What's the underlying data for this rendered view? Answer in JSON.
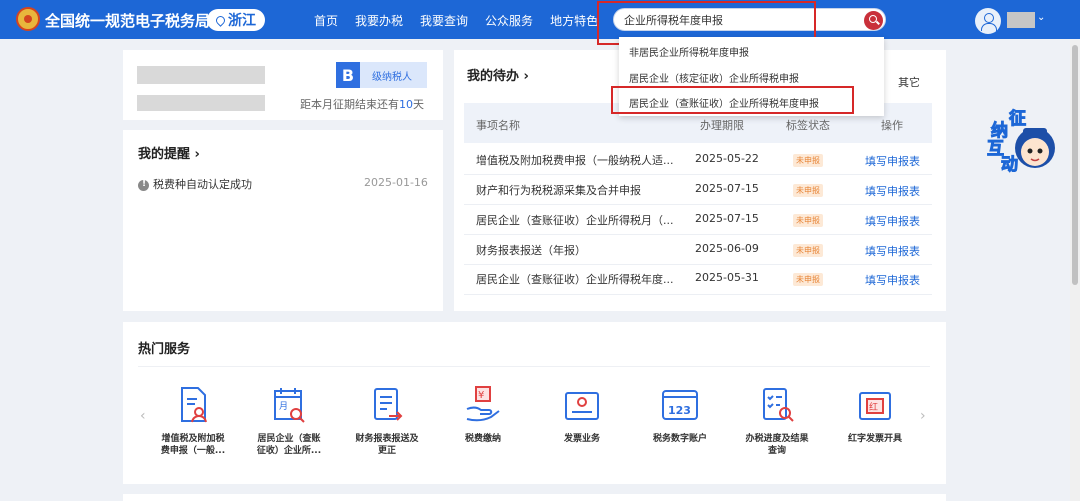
{
  "header": {
    "site_title": "全国统一规范电子税务局",
    "region": "浙江",
    "nav": [
      "首页",
      "我要办税",
      "我要查询",
      "公众服务",
      "地方特色"
    ],
    "search_value": "企业所得税年度申报"
  },
  "search_suggestions": [
    "非居民企业所得税年度申报",
    "居民企业（核定征收）企业所得税申报",
    "居民企业（查账征收）企业所得税年度申报"
  ],
  "profile": {
    "grade_letter": "B",
    "grade_text": "级纳税人",
    "deadline_prefix": "距本月征期结束还有",
    "deadline_days": "10",
    "deadline_suffix": "天"
  },
  "reminders": {
    "title": "我的提醒",
    "items": [
      {
        "text": "税费种自动认定成功",
        "date": "2025-01-16"
      }
    ]
  },
  "todo": {
    "title": "我的待办",
    "other_link": "其它",
    "columns": [
      "事项名称",
      "办理期限",
      "标签状态",
      "操作"
    ],
    "rows": [
      {
        "name": "增值税及附加税费申报（一般纳税人适...",
        "deadline": "2025-05-22",
        "status": "未申报",
        "action": "填写申报表"
      },
      {
        "name": "财产和行为税税源采集及合并申报",
        "deadline": "2025-07-15",
        "status": "未申报",
        "action": "填写申报表"
      },
      {
        "name": "居民企业（查账征收）企业所得税月（...",
        "deadline": "2025-07-15",
        "status": "未申报",
        "action": "填写申报表"
      },
      {
        "name": "财务报表报送（年报）",
        "deadline": "2025-06-09",
        "status": "未申报",
        "action": "填写申报表"
      },
      {
        "name": "居民企业（查账征收）企业所得税年度...",
        "deadline": "2025-05-31",
        "status": "未申报",
        "action": "填写申报表"
      }
    ]
  },
  "hot_services": {
    "title": "热门服务",
    "items": [
      {
        "label_line1": "增值税及附加税",
        "label_line2": "费申报（一般...",
        "icon": "doc-person-icon"
      },
      {
        "label_line1": "居民企业（查账",
        "label_line2": "征收）企业所...",
        "icon": "calendar-search-icon"
      },
      {
        "label_line1": "财务报表报送及",
        "label_line2": "更正",
        "icon": "report-arrow-icon"
      },
      {
        "label_line1": "税费缴纳",
        "label_line2": "",
        "icon": "hand-coin-icon"
      },
      {
        "label_line1": "发票业务",
        "label_line2": "",
        "icon": "invoice-icon"
      },
      {
        "label_line1": "税务数字账户",
        "label_line2": "",
        "icon": "digital-account-icon"
      },
      {
        "label_line1": "办税进度及结果",
        "label_line2": "查询",
        "icon": "progress-search-icon"
      },
      {
        "label_line1": "红字发票开具",
        "label_line2": "",
        "icon": "red-invoice-icon"
      }
    ]
  },
  "mascot": {
    "chars": [
      "征",
      "纳",
      "互",
      "动"
    ]
  },
  "colors": {
    "brand": "#1d67d6",
    "alert": "#d62828",
    "tag": "#e8873a"
  }
}
